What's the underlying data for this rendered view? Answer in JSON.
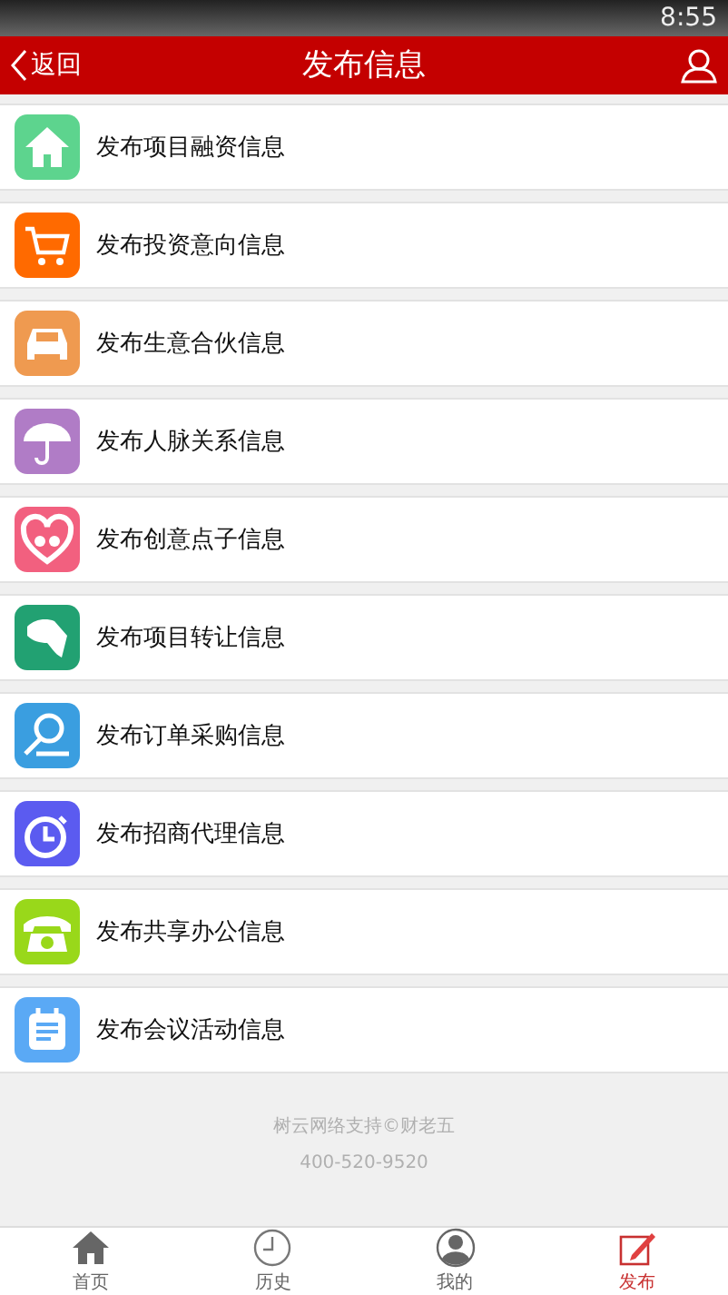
{
  "status_bar": {
    "time": "8:55"
  },
  "header": {
    "back": "返回",
    "title": "发布信息"
  },
  "items": [
    {
      "label": "发布项目融资信息",
      "kind": "house",
      "color": "#5dd48e"
    },
    {
      "label": "发布投资意向信息",
      "kind": "cart",
      "color": "#ff6a00"
    },
    {
      "label": "发布生意合伙信息",
      "kind": "car",
      "color": "#ef9a50"
    },
    {
      "label": "发布人脉关系信息",
      "kind": "umbrella",
      "color": "#b07cc6"
    },
    {
      "label": "发布创意点子信息",
      "kind": "heart",
      "color": "#f2607f"
    },
    {
      "label": "发布项目转让信息",
      "kind": "dog",
      "color": "#22a172"
    },
    {
      "label": "发布订单采购信息",
      "kind": "magnifier",
      "color": "#3a9ee0"
    },
    {
      "label": "发布招商代理信息",
      "kind": "stopwatch",
      "color": "#5b5bf0"
    },
    {
      "label": "发布共享办公信息",
      "kind": "phone",
      "color": "#99d81a"
    },
    {
      "label": "发布会议活动信息",
      "kind": "calendar",
      "color": "#5aa9f5"
    }
  ],
  "footer": {
    "credit": "树云网络支持©财老五",
    "phone": "400-520-9520"
  },
  "tab_bar": [
    {
      "label": "首页",
      "kind": "home",
      "selected": false
    },
    {
      "label": "历史",
      "kind": "clock",
      "selected": false
    },
    {
      "label": "我的",
      "kind": "person",
      "selected": false
    },
    {
      "label": "发布",
      "kind": "edit",
      "selected": true
    }
  ]
}
